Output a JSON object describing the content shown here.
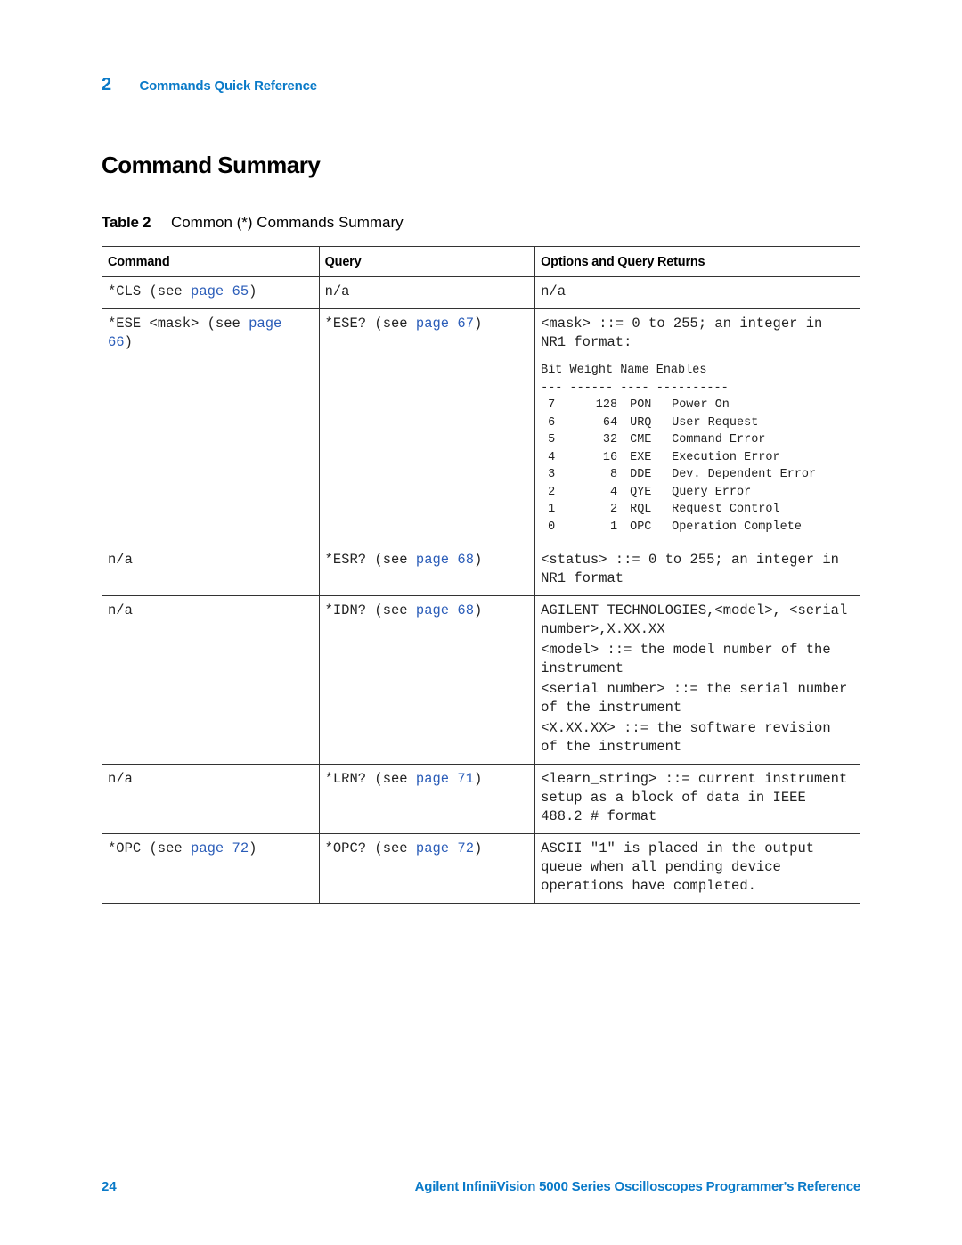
{
  "header": {
    "chapter_number": "2",
    "chapter_title": "Commands Quick Reference"
  },
  "page_title": "Command Summary",
  "table_caption": {
    "label": "Table 2",
    "title": "Common (*) Commands Summary"
  },
  "table": {
    "columns": [
      "Command",
      "Query",
      "Options and Query Returns"
    ],
    "rows": [
      {
        "command": {
          "text": "*CLS (see ",
          "link": "page 65",
          "suffix": ")"
        },
        "query": {
          "text": "n/a",
          "link": "",
          "suffix": ""
        },
        "returns": [
          "n/a"
        ]
      },
      {
        "command": {
          "text": "*ESE <mask> (see ",
          "link": "page 66",
          "suffix": ")"
        },
        "query": {
          "text": "*ESE? (see ",
          "link": "page 67",
          "suffix": ")"
        },
        "returns": [
          "<mask> ::= 0 to 255; an integer in NR1 format:"
        ],
        "bit_table": {
          "header": "Bit Weight Name Enables",
          "separator": "--- ------ ---- ----------",
          "rows": [
            {
              "bit": "7",
              "weight": "128",
              "name": "PON",
              "enables": "Power On"
            },
            {
              "bit": "6",
              "weight": "64",
              "name": "URQ",
              "enables": "User Request"
            },
            {
              "bit": "5",
              "weight": "32",
              "name": "CME",
              "enables": "Command Error"
            },
            {
              "bit": "4",
              "weight": "16",
              "name": "EXE",
              "enables": "Execution Error"
            },
            {
              "bit": "3",
              "weight": "8",
              "name": "DDE",
              "enables": "Dev. Dependent Error"
            },
            {
              "bit": "2",
              "weight": "4",
              "name": "QYE",
              "enables": "Query Error"
            },
            {
              "bit": "1",
              "weight": "2",
              "name": "RQL",
              "enables": "Request Control"
            },
            {
              "bit": "0",
              "weight": "1",
              "name": "OPC",
              "enables": "Operation Complete"
            }
          ]
        }
      },
      {
        "command": {
          "text": "n/a",
          "link": "",
          "suffix": ""
        },
        "query": {
          "text": "*ESR? (see ",
          "link": "page 68",
          "suffix": ")"
        },
        "returns": [
          "<status> ::= 0 to 255; an integer in NR1 format"
        ]
      },
      {
        "command": {
          "text": "n/a",
          "link": "",
          "suffix": ""
        },
        "query": {
          "text": "*IDN? (see ",
          "link": "page 68",
          "suffix": ")"
        },
        "returns": [
          "AGILENT TECHNOLOGIES,<model>, <serial number>,X.XX.XX",
          "<model> ::= the model number of the instrument",
          "<serial number> ::= the serial number of the instrument",
          "<X.XX.XX> ::= the software revision of the instrument"
        ]
      },
      {
        "command": {
          "text": "n/a",
          "link": "",
          "suffix": ""
        },
        "query": {
          "text": "*LRN? (see ",
          "link": "page 71",
          "suffix": ")"
        },
        "returns": [
          "<learn_string> ::= current instrument setup as a block of data in IEEE 488.2 # format"
        ]
      },
      {
        "command": {
          "text": "*OPC (see ",
          "link": "page 72",
          "suffix": ")"
        },
        "query": {
          "text": "*OPC? (see ",
          "link": "page 72",
          "suffix": ")"
        },
        "returns": [
          "ASCII \"1\" is placed in the output queue when all pending device operations have completed."
        ]
      }
    ]
  },
  "footer": {
    "page_number": "24",
    "document_title": "Agilent InfiniiVision 5000 Series Oscilloscopes Programmer's Reference"
  },
  "colors": {
    "accent": "#0a7ac8",
    "link": "#2a5cb8"
  }
}
